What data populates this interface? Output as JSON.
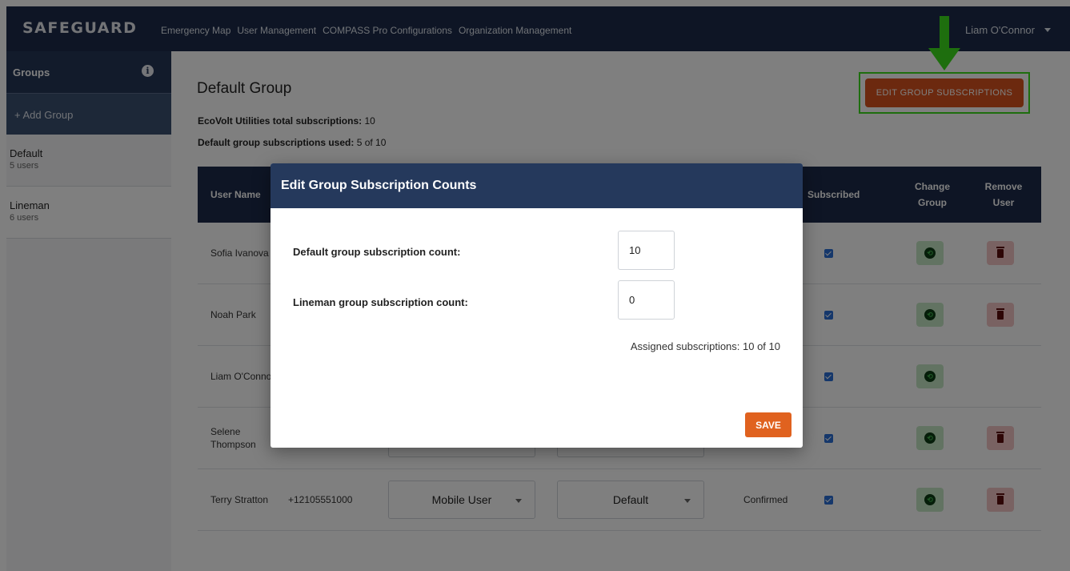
{
  "app": {
    "logo": "SAFEGUARD"
  },
  "nav": {
    "items": [
      "Emergency Map",
      "User Management",
      "COMPASS Pro Configurations",
      "Organization Management"
    ]
  },
  "user": {
    "name": "Liam O'Connor"
  },
  "sidebar": {
    "title": "Groups",
    "add_label": "+ Add Group",
    "groups": [
      {
        "name": "Default",
        "count": "5 users"
      },
      {
        "name": "Lineman",
        "count": "6 users"
      }
    ]
  },
  "main": {
    "title": "Default Group",
    "total_label": "EcoVolt Utilities total subscriptions:",
    "total_value": "10",
    "used_label": "Default group subscriptions used:",
    "used_value": "5 of 10",
    "edit_button": "EDIT GROUP SUBSCRIPTIONS"
  },
  "table": {
    "headers": {
      "user_name": "User Name",
      "subscribed": "Subscribed",
      "change_group": [
        "Change",
        "Group"
      ],
      "remove_user": [
        "Remove",
        "User"
      ]
    },
    "rows": [
      {
        "name": "Sofia Ivanova"
      },
      {
        "name": "Noah Park"
      },
      {
        "name": "Liam O'Conno"
      },
      {
        "name": "Selene Thompson"
      },
      {
        "name": "Terry Stratton",
        "phone": "+12105551000",
        "role": "Mobile User",
        "group": "Default",
        "status": "Confirmed"
      }
    ]
  },
  "modal": {
    "title": "Edit Group Subscription Counts",
    "default_label": "Default group subscription count:",
    "default_value": "10",
    "lineman_label": "Lineman group subscription count:",
    "lineman_value": "0",
    "assigned": "Assigned subscriptions: 10 of 10",
    "save": "SAVE"
  },
  "colors": {
    "nav_bg": "#1c2b4a",
    "accent": "#d9531e",
    "highlight": "#3cdc1c"
  }
}
